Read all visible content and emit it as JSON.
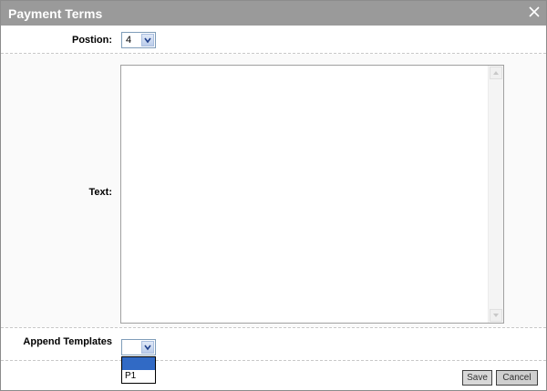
{
  "dialog": {
    "title": "Payment Terms",
    "close_label": "×"
  },
  "position": {
    "label": "Postion:",
    "value": "4"
  },
  "text": {
    "label": "Text:",
    "value": ""
  },
  "append": {
    "label": "Append Templates",
    "value": "",
    "options": [
      "",
      "P1"
    ]
  },
  "actions": {
    "save_label": "Save",
    "cancel_label": "Cancel"
  },
  "colors": {
    "titlebar": "#9a9a9a",
    "selection": "#316ac5"
  }
}
